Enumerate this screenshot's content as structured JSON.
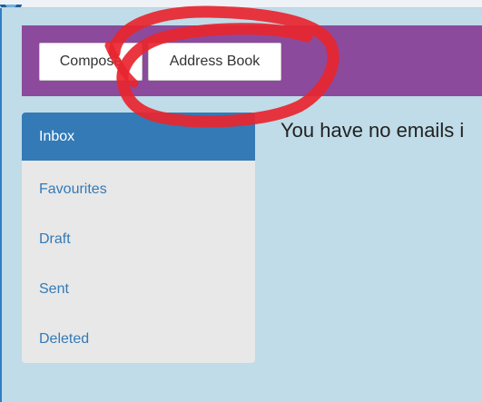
{
  "toolbar": {
    "compose_label": "Compose",
    "address_book_label": "Address Book"
  },
  "sidebar": {
    "items": [
      {
        "label": "Inbox"
      },
      {
        "label": "Favourites"
      },
      {
        "label": "Draft"
      },
      {
        "label": "Sent"
      },
      {
        "label": "Deleted"
      }
    ],
    "active_index": 0
  },
  "main": {
    "empty_message": "You have no emails i"
  },
  "colors": {
    "background": "#bfdce8",
    "toolbar": "#8c4a9c",
    "active_item": "#337ab7",
    "link": "#337ab7",
    "annotation_stroke": "#e8252e"
  }
}
